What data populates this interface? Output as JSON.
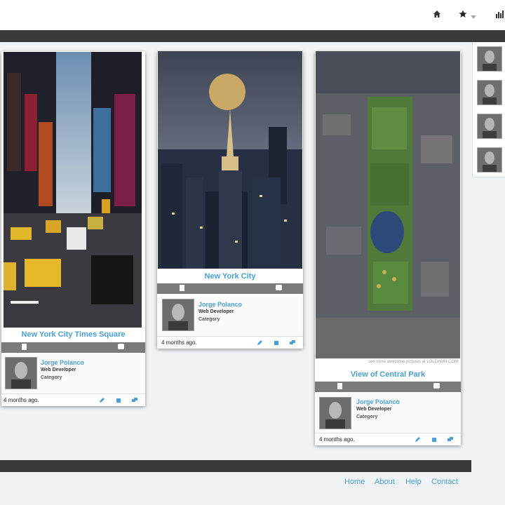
{
  "nav": {
    "icons": [
      "home-icon",
      "star-icon",
      "caret-down-icon",
      "bar-chart-icon"
    ]
  },
  "posts": [
    {
      "title": "New York City Times Square",
      "image": "times-square-photo",
      "author": "Jorge Polanco",
      "role": "Web Developer",
      "category": "Category",
      "time": "4 months ago."
    },
    {
      "title": "New York City",
      "image": "chrysler-building-moon-photo",
      "author": "Jorge Polanco",
      "role": "Web Developer",
      "category": "Category",
      "time": "4 months ago."
    },
    {
      "title": "View of Central Park",
      "image": "central-park-aerial-photo",
      "watermark": "see more awesome pictures at LOLDAMN.COM",
      "author": "Jorge Polanco",
      "role": "Web Developer",
      "category": "Category",
      "time": "4 months ago."
    }
  ],
  "footer": {
    "links": [
      "Home",
      "About",
      "Help",
      "Contact"
    ]
  },
  "colors": {
    "accent": "#4a9fd4",
    "dark_bar": "#3a3a3a",
    "action_bar": "#7a7a7a",
    "background": "#f0f3f6"
  }
}
